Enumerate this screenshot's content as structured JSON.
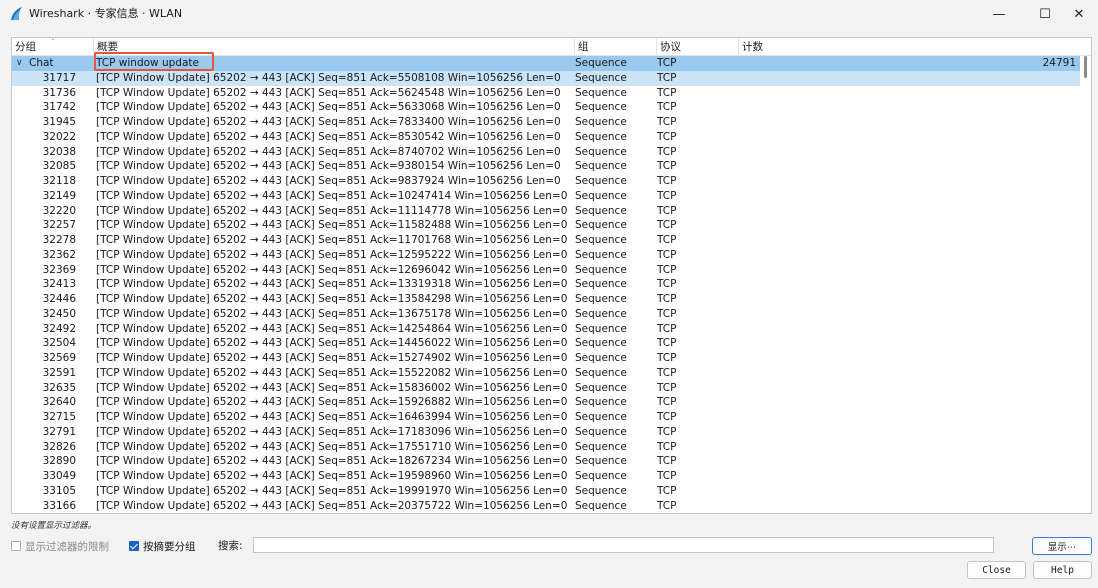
{
  "window": {
    "title": "Wireshark · 专家信息 · WLAN",
    "minimize": "—",
    "maximize": "☐",
    "close": "✕"
  },
  "columns": [
    "分组",
    "概要",
    "组",
    "协议",
    "计数"
  ],
  "parent_row": {
    "group": "Chat",
    "summary": "TCP window update",
    "grp": "Sequence",
    "proto": "TCP",
    "count": "24791"
  },
  "rows": [
    {
      "id": "31717",
      "summary": "[TCP Window Update] 65202 → 443 [ACK] Seq=851 Ack=5508108 Win=1056256 Len=0",
      "grp": "Sequence",
      "proto": "TCP"
    },
    {
      "id": "31736",
      "summary": "[TCP Window Update] 65202 → 443 [ACK] Seq=851 Ack=5624548 Win=1056256 Len=0",
      "grp": "Sequence",
      "proto": "TCP"
    },
    {
      "id": "31742",
      "summary": "[TCP Window Update] 65202 → 443 [ACK] Seq=851 Ack=5633068 Win=1056256 Len=0",
      "grp": "Sequence",
      "proto": "TCP"
    },
    {
      "id": "31945",
      "summary": "[TCP Window Update] 65202 → 443 [ACK] Seq=851 Ack=7833400 Win=1056256 Len=0",
      "grp": "Sequence",
      "proto": "TCP"
    },
    {
      "id": "32022",
      "summary": "[TCP Window Update] 65202 → 443 [ACK] Seq=851 Ack=8530542 Win=1056256 Len=0",
      "grp": "Sequence",
      "proto": "TCP"
    },
    {
      "id": "32038",
      "summary": "[TCP Window Update] 65202 → 443 [ACK] Seq=851 Ack=8740702 Win=1056256 Len=0",
      "grp": "Sequence",
      "proto": "TCP"
    },
    {
      "id": "32085",
      "summary": "[TCP Window Update] 65202 → 443 [ACK] Seq=851 Ack=9380154 Win=1056256 Len=0",
      "grp": "Sequence",
      "proto": "TCP"
    },
    {
      "id": "32118",
      "summary": "[TCP Window Update] 65202 → 443 [ACK] Seq=851 Ack=9837924 Win=1056256 Len=0",
      "grp": "Sequence",
      "proto": "TCP"
    },
    {
      "id": "32149",
      "summary": "[TCP Window Update] 65202 → 443 [ACK] Seq=851 Ack=10247414 Win=1056256 Len=0",
      "grp": "Sequence",
      "proto": "TCP"
    },
    {
      "id": "32220",
      "summary": "[TCP Window Update] 65202 → 443 [ACK] Seq=851 Ack=11114778 Win=1056256 Len=0",
      "grp": "Sequence",
      "proto": "TCP"
    },
    {
      "id": "32257",
      "summary": "[TCP Window Update] 65202 → 443 [ACK] Seq=851 Ack=11582488 Win=1056256 Len=0",
      "grp": "Sequence",
      "proto": "TCP"
    },
    {
      "id": "32278",
      "summary": "[TCP Window Update] 65202 → 443 [ACK] Seq=851 Ack=11701768 Win=1056256 Len=0",
      "grp": "Sequence",
      "proto": "TCP"
    },
    {
      "id": "32362",
      "summary": "[TCP Window Update] 65202 → 443 [ACK] Seq=851 Ack=12595222 Win=1056256 Len=0",
      "grp": "Sequence",
      "proto": "TCP"
    },
    {
      "id": "32369",
      "summary": "[TCP Window Update] 65202 → 443 [ACK] Seq=851 Ack=12696042 Win=1056256 Len=0",
      "grp": "Sequence",
      "proto": "TCP"
    },
    {
      "id": "32413",
      "summary": "[TCP Window Update] 65202 → 443 [ACK] Seq=851 Ack=13319318 Win=1056256 Len=0",
      "grp": "Sequence",
      "proto": "TCP"
    },
    {
      "id": "32446",
      "summary": "[TCP Window Update] 65202 → 443 [ACK] Seq=851 Ack=13584298 Win=1056256 Len=0",
      "grp": "Sequence",
      "proto": "TCP"
    },
    {
      "id": "32450",
      "summary": "[TCP Window Update] 65202 → 443 [ACK] Seq=851 Ack=13675178 Win=1056256 Len=0",
      "grp": "Sequence",
      "proto": "TCP"
    },
    {
      "id": "32492",
      "summary": "[TCP Window Update] 65202 → 443 [ACK] Seq=851 Ack=14254864 Win=1056256 Len=0",
      "grp": "Sequence",
      "proto": "TCP"
    },
    {
      "id": "32504",
      "summary": "[TCP Window Update] 65202 → 443 [ACK] Seq=851 Ack=14456022 Win=1056256 Len=0",
      "grp": "Sequence",
      "proto": "TCP"
    },
    {
      "id": "32569",
      "summary": "[TCP Window Update] 65202 → 443 [ACK] Seq=851 Ack=15274902 Win=1056256 Len=0",
      "grp": "Sequence",
      "proto": "TCP"
    },
    {
      "id": "32591",
      "summary": "[TCP Window Update] 65202 → 443 [ACK] Seq=851 Ack=15522082 Win=1056256 Len=0",
      "grp": "Sequence",
      "proto": "TCP"
    },
    {
      "id": "32635",
      "summary": "[TCP Window Update] 65202 → 443 [ACK] Seq=851 Ack=15836002 Win=1056256 Len=0",
      "grp": "Sequence",
      "proto": "TCP"
    },
    {
      "id": "32640",
      "summary": "[TCP Window Update] 65202 → 443 [ACK] Seq=851 Ack=15926882 Win=1056256 Len=0",
      "grp": "Sequence",
      "proto": "TCP"
    },
    {
      "id": "32715",
      "summary": "[TCP Window Update] 65202 → 443 [ACK] Seq=851 Ack=16463994 Win=1056256 Len=0",
      "grp": "Sequence",
      "proto": "TCP"
    },
    {
      "id": "32791",
      "summary": "[TCP Window Update] 65202 → 443 [ACK] Seq=851 Ack=17183096 Win=1056256 Len=0",
      "grp": "Sequence",
      "proto": "TCP"
    },
    {
      "id": "32826",
      "summary": "[TCP Window Update] 65202 → 443 [ACK] Seq=851 Ack=17551710 Win=1056256 Len=0",
      "grp": "Sequence",
      "proto": "TCP"
    },
    {
      "id": "32890",
      "summary": "[TCP Window Update] 65202 → 443 [ACK] Seq=851 Ack=18267234 Win=1056256 Len=0",
      "grp": "Sequence",
      "proto": "TCP"
    },
    {
      "id": "33049",
      "summary": "[TCP Window Update] 65202 → 443 [ACK] Seq=851 Ack=19598960 Win=1056256 Len=0",
      "grp": "Sequence",
      "proto": "TCP"
    },
    {
      "id": "33105",
      "summary": "[TCP Window Update] 65202 → 443 [ACK] Seq=851 Ack=19991970 Win=1056256 Len=0",
      "grp": "Sequence",
      "proto": "TCP"
    },
    {
      "id": "33166",
      "summary": "[TCP Window Update] 65202 → 443 [ACK] Seq=851 Ack=20375722 Win=1056256 Len=0",
      "grp": "Sequence",
      "proto": "TCP"
    }
  ],
  "status_note": "没有设置显示过滤器。",
  "options": {
    "filter_limit_label": "显示过滤器的限制",
    "filter_limit_checked": false,
    "group_by_summary_label": "按摘要分组",
    "group_by_summary_checked": true
  },
  "search": {
    "label": "搜索:",
    "value": ""
  },
  "buttons": {
    "show": "显示⋯",
    "close": "Close",
    "help": "Help"
  },
  "colors": {
    "selected_row": "#99c9ef",
    "hover_row": "#cce4f7",
    "annotation_box": "#e0573b"
  }
}
